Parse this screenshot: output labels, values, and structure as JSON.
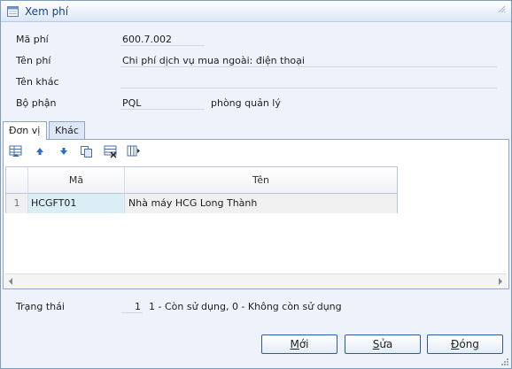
{
  "window": {
    "title": "Xem phí",
    "icon": "form-icon"
  },
  "form": {
    "fields": [
      {
        "label": "Mã phí",
        "value": "600.7.002"
      },
      {
        "label": "Tên phí",
        "value": "Chi phí dịch vụ mua ngoài: điện thoại"
      },
      {
        "label": "Tên khác",
        "value": ""
      },
      {
        "label": "Bộ phận",
        "value": "PQL",
        "extra": "phòng quản lý"
      }
    ]
  },
  "tabs": [
    {
      "label": "Đơn vị",
      "active": true
    },
    {
      "label": "Khác",
      "active": false
    }
  ],
  "toolbar": {
    "icons": [
      "insert-row-icon",
      "move-up-icon",
      "move-down-icon",
      "copy-icon",
      "delete-row-icon",
      "columns-icon"
    ]
  },
  "grid": {
    "columns": [
      "Mã",
      "Tên"
    ],
    "rows": [
      {
        "num": "1",
        "ma": "HCGFT01",
        "ten": "Nhà máy HCG Long Thành"
      }
    ]
  },
  "status": {
    "label": "Trạng thái",
    "value": "1",
    "description": "1 - Còn sử dụng, 0 - Không còn sử dụng"
  },
  "buttons": {
    "new": {
      "prefix": "",
      "underline": "M",
      "suffix": "ới"
    },
    "edit": {
      "prefix": "",
      "underline": "S",
      "suffix": "ửa"
    },
    "close": {
      "prefix": "",
      "underline": "Đ",
      "suffix": "óng"
    }
  },
  "colors": {
    "title_text": "#15428b",
    "selected_cell": "#dbeef5",
    "row_bg": "#f0f0f0"
  }
}
